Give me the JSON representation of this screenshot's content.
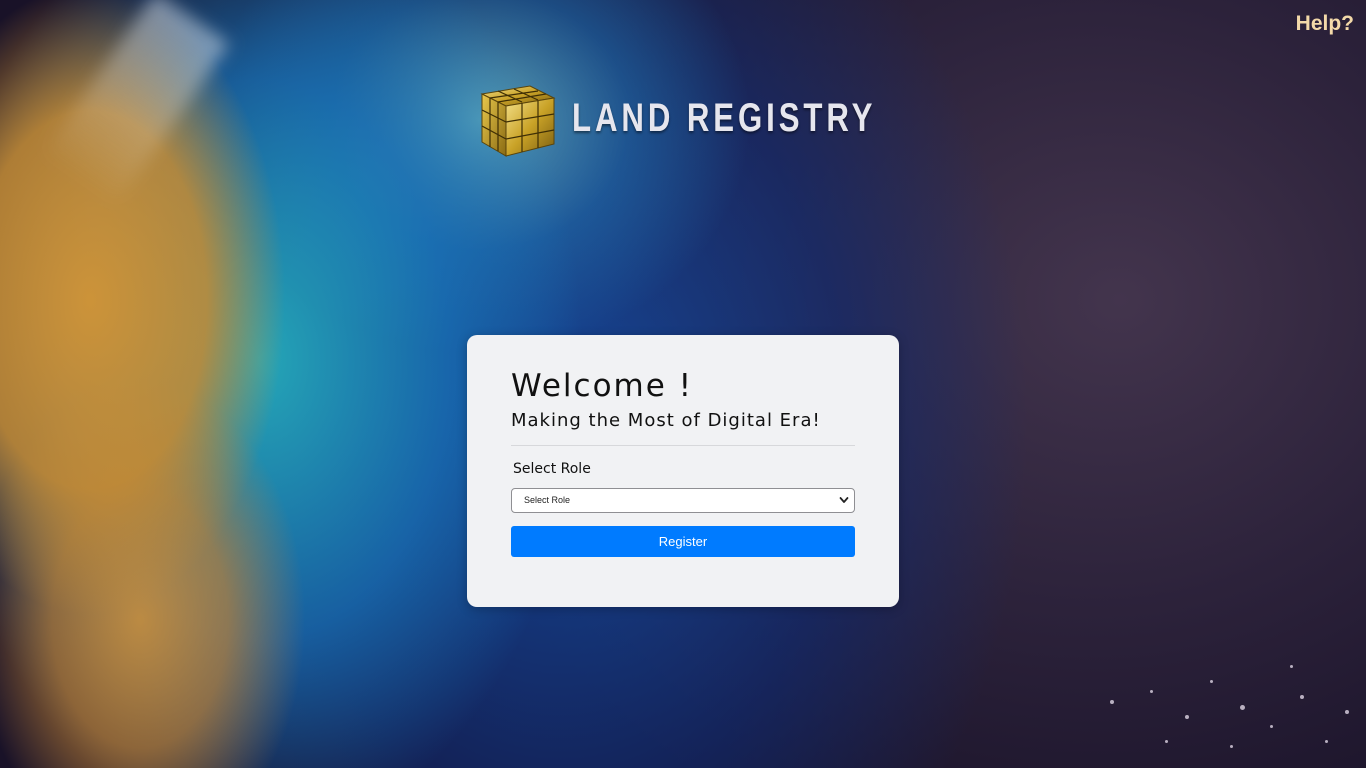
{
  "header": {
    "help_label": "Help?"
  },
  "logo": {
    "text": "LAND REGISTRY",
    "icon": "gold-cube-icon"
  },
  "card": {
    "title": "Welcome !",
    "subtitle": "Making the Most of Digital Era!",
    "role_label": "Select Role",
    "role_select": {
      "selected": "Select Role",
      "options": [
        "Select Role"
      ]
    },
    "register_label": "Register"
  },
  "colors": {
    "accent": "#007bff",
    "help_text": "#f3d9a9",
    "card_bg": "#f1f2f4",
    "logo_gold": "#c9a227"
  }
}
